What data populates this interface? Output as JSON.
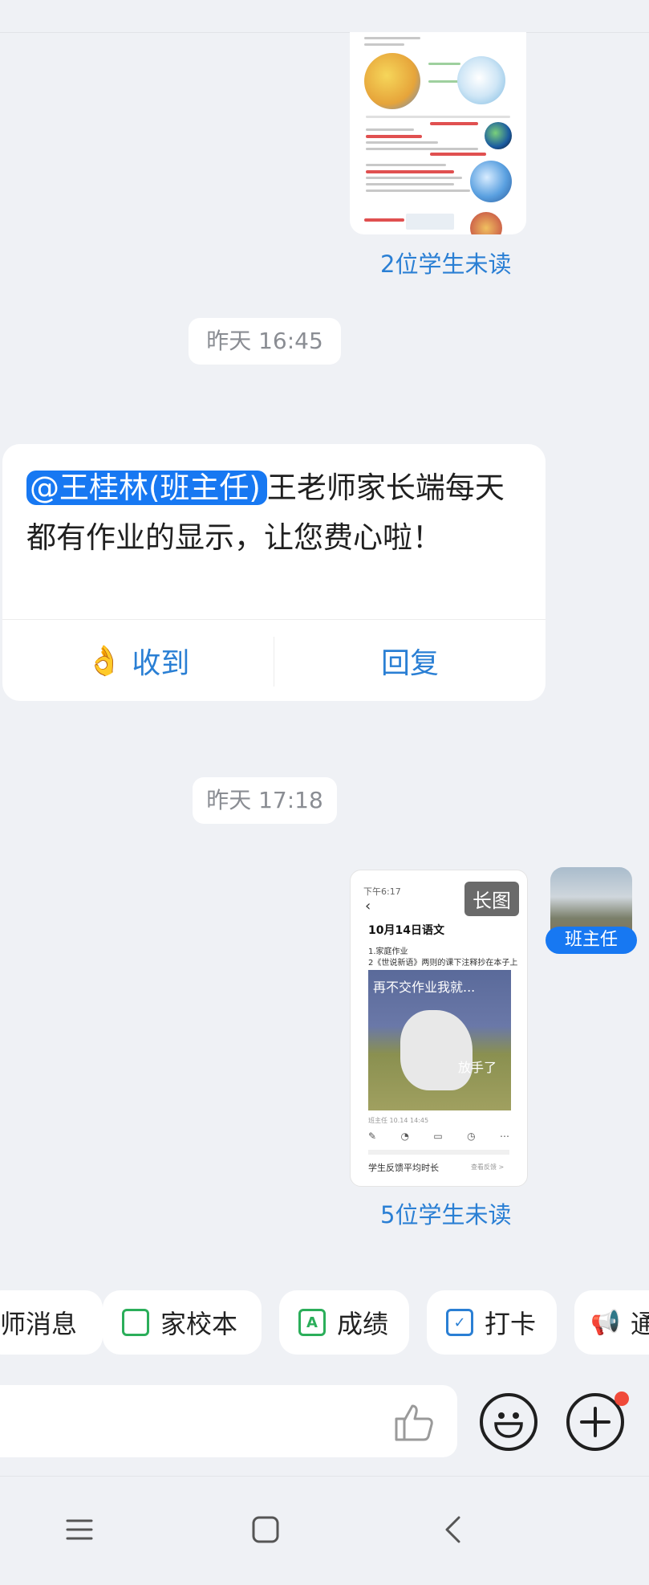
{
  "messages": {
    "doc_image": {
      "unread": "2位学生未读"
    },
    "time_1": "昨天 16:45",
    "mention_msg": {
      "mention": "@王桂林(班主任)",
      "text": "王老师家长端每天都有作业的显示，让您费心啦！",
      "ack_emoji": "👌",
      "ack_label": "收到",
      "reply_label": "回复"
    },
    "time_2": "昨天 17:18",
    "long_image": {
      "badge": "长图",
      "status_bar": "下午6:17",
      "title": "10月14日语文",
      "line1": "1.家庭作业",
      "line2": "2《世说新语》两则的课下注释抄在本子上",
      "meme_top": "再不交作业我就...",
      "meme_bottom": "放手了",
      "author": "班主任 10.14 14:45",
      "footer": "学生反馈平均时长",
      "footer_link": "查看反馈 >",
      "unread": "5位学生未读"
    },
    "sender_role": "班主任"
  },
  "quick_actions": [
    {
      "label": "师消息",
      "color": "#333333"
    },
    {
      "label": "家校本",
      "color": "#2bae5a"
    },
    {
      "label": "成绩",
      "color": "#2bae5a"
    },
    {
      "label": "打卡",
      "color": "#2a7fd4"
    },
    {
      "label": "通",
      "color": "#f07a2a"
    }
  ],
  "input": {
    "placeholder": ""
  },
  "colors": {
    "accent": "#1778f2",
    "link": "#2a7fd4",
    "badge": "#f04a3a"
  }
}
